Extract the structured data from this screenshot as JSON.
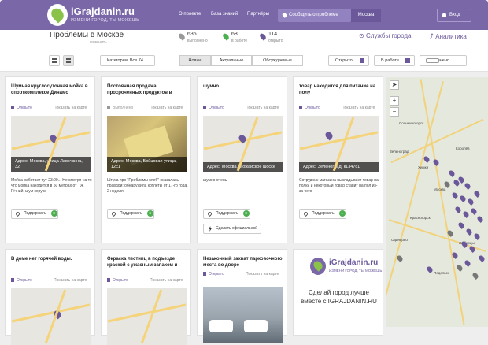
{
  "header": {
    "logo_name": "iGrajdanin.ru",
    "logo_tagline": "ИЗМЕНИ ГОРОД, ТЫ МОЖЕШЬ",
    "nav": [
      "О проекте",
      "База знаний",
      "Партнёры"
    ],
    "report_label": "Сообщить о проблеме",
    "city_label": "Москва",
    "login_label": "Вход"
  },
  "subheader": {
    "title": "Проблемы в Москве",
    "change_label": "изменить",
    "stats": [
      {
        "num": "636",
        "label": "выполнено",
        "color": "#999999"
      },
      {
        "num": "68",
        "label": "в работе",
        "color": "#4caf50"
      },
      {
        "num": "114",
        "label": "открыто",
        "color": "#6a589b"
      }
    ],
    "services_label": "Службы города",
    "analytics_label": "Аналитика"
  },
  "filters": {
    "category_label": "Категории: Все 74",
    "tabs": [
      "Новые",
      "Актуальные",
      "Обсуждаемые"
    ],
    "status_checks": [
      {
        "label": "Открыто",
        "checked": true
      },
      {
        "label": "В работе",
        "checked": true
      },
      {
        "label": "Выполнено",
        "checked": false
      }
    ]
  },
  "cards": [
    {
      "title": "Шумная круглосуточная мойка в спорткомплексе Динамо",
      "status": "Открыто",
      "map_link": "Показать на карте",
      "address": "Адрес: Москва, улица Лавочкина, 32",
      "desc": "Мойка работает тут 23:00... Не смотря на то что мойка находится в 50 метрах от ТЖ Річний, шум керуке",
      "support": "Поддержать",
      "count": "0"
    },
    {
      "title": "Постоянная продажа просроченных продуктов в",
      "status": "Выполнено",
      "map_link": "Показать на карте",
      "address": "Адрес: Москва, Бойцовая улица, 12с1",
      "desc": "Штука про \"Проблемы хлеб\" оказалась правдой: обнаружила котлеты от 17-го года, 2 неделя",
      "support": "Поддержать",
      "count": "3"
    },
    {
      "title": "шумно",
      "status": "Открыто",
      "map_link": "Показать на карте",
      "address": "Адрес: Москва, Можайское шоссе",
      "desc": "шумно очень",
      "support": "Поддержать",
      "count": "0",
      "official": "Сделать официальной"
    },
    {
      "title": "товар находится для питание на полу",
      "status": "Открыто",
      "map_link": "Показать на карте",
      "address": "Адрес: Зеленоград, к1347с1",
      "desc": "Сотрудник магазина выкладывает товар на полки и некоторый товар ставит на пол из-за чего",
      "support": "Поддержать",
      "count": "1"
    },
    {
      "title": "В доме нет горячей воды.",
      "status": "Открыто",
      "map_link": "Показать на карте"
    },
    {
      "title": "Окраска лестниц в подъезде краской с ужасным запахом и",
      "status": "Открыто",
      "map_link": "Показать на карте"
    },
    {
      "title": "Незаконный захват парковочного места во дворе",
      "status": "Открыто",
      "map_link": "Показать на карте"
    }
  ],
  "promo": {
    "name": "iGrajdanin.ru",
    "tagline": "ИЗМЕНИ ГОРОД, ТЫ МОЖЕШЬ",
    "line1": "Сделай город лучше",
    "line2": "вместе",
    "line3": "с IGRAJDANIN.RU"
  },
  "map": {
    "towns": [
      "Солнечногорск",
      "Королёв",
      "Москва",
      "Красногорск",
      "Подольск",
      "Химки",
      "Одинцово",
      "Люберцы",
      "Зеленоград"
    ],
    "zoom_in": "+",
    "zoom_out": "−"
  }
}
